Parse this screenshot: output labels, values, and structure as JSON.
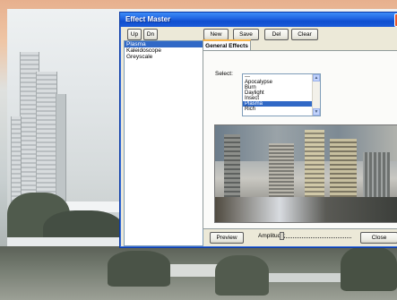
{
  "window": {
    "title": "Effect Master",
    "close_glyph": "✕"
  },
  "toolbar": {
    "up_label": "Up",
    "dn_label": "Dn",
    "new_label": "New",
    "save_label": "Save",
    "del_label": "Del",
    "clear_label": "Clear"
  },
  "effect_chain": {
    "items": [
      "Plasma",
      "Kaleidoscope",
      "Greyscale"
    ],
    "selected_index": 0
  },
  "tabs": {
    "general": "General Effects"
  },
  "general_effects": {
    "select_label": "Select:",
    "options": [
      "---",
      "Apocalypse",
      "Burn",
      "Daylight",
      "Insect",
      "Plasma",
      "Rich"
    ],
    "selected": "Plasma"
  },
  "bottom_bar": {
    "preview_label": "Preview",
    "amplitude_label": "Amplitude:",
    "close_label": "Close"
  },
  "colors": {
    "titlebar": "#1f63e0",
    "selection": "#3169c6",
    "dialog_bg": "#ece9d8",
    "outer_frame": "#e98f50"
  },
  "icons": {
    "scroll_up": "▲",
    "scroll_down": "▼"
  }
}
